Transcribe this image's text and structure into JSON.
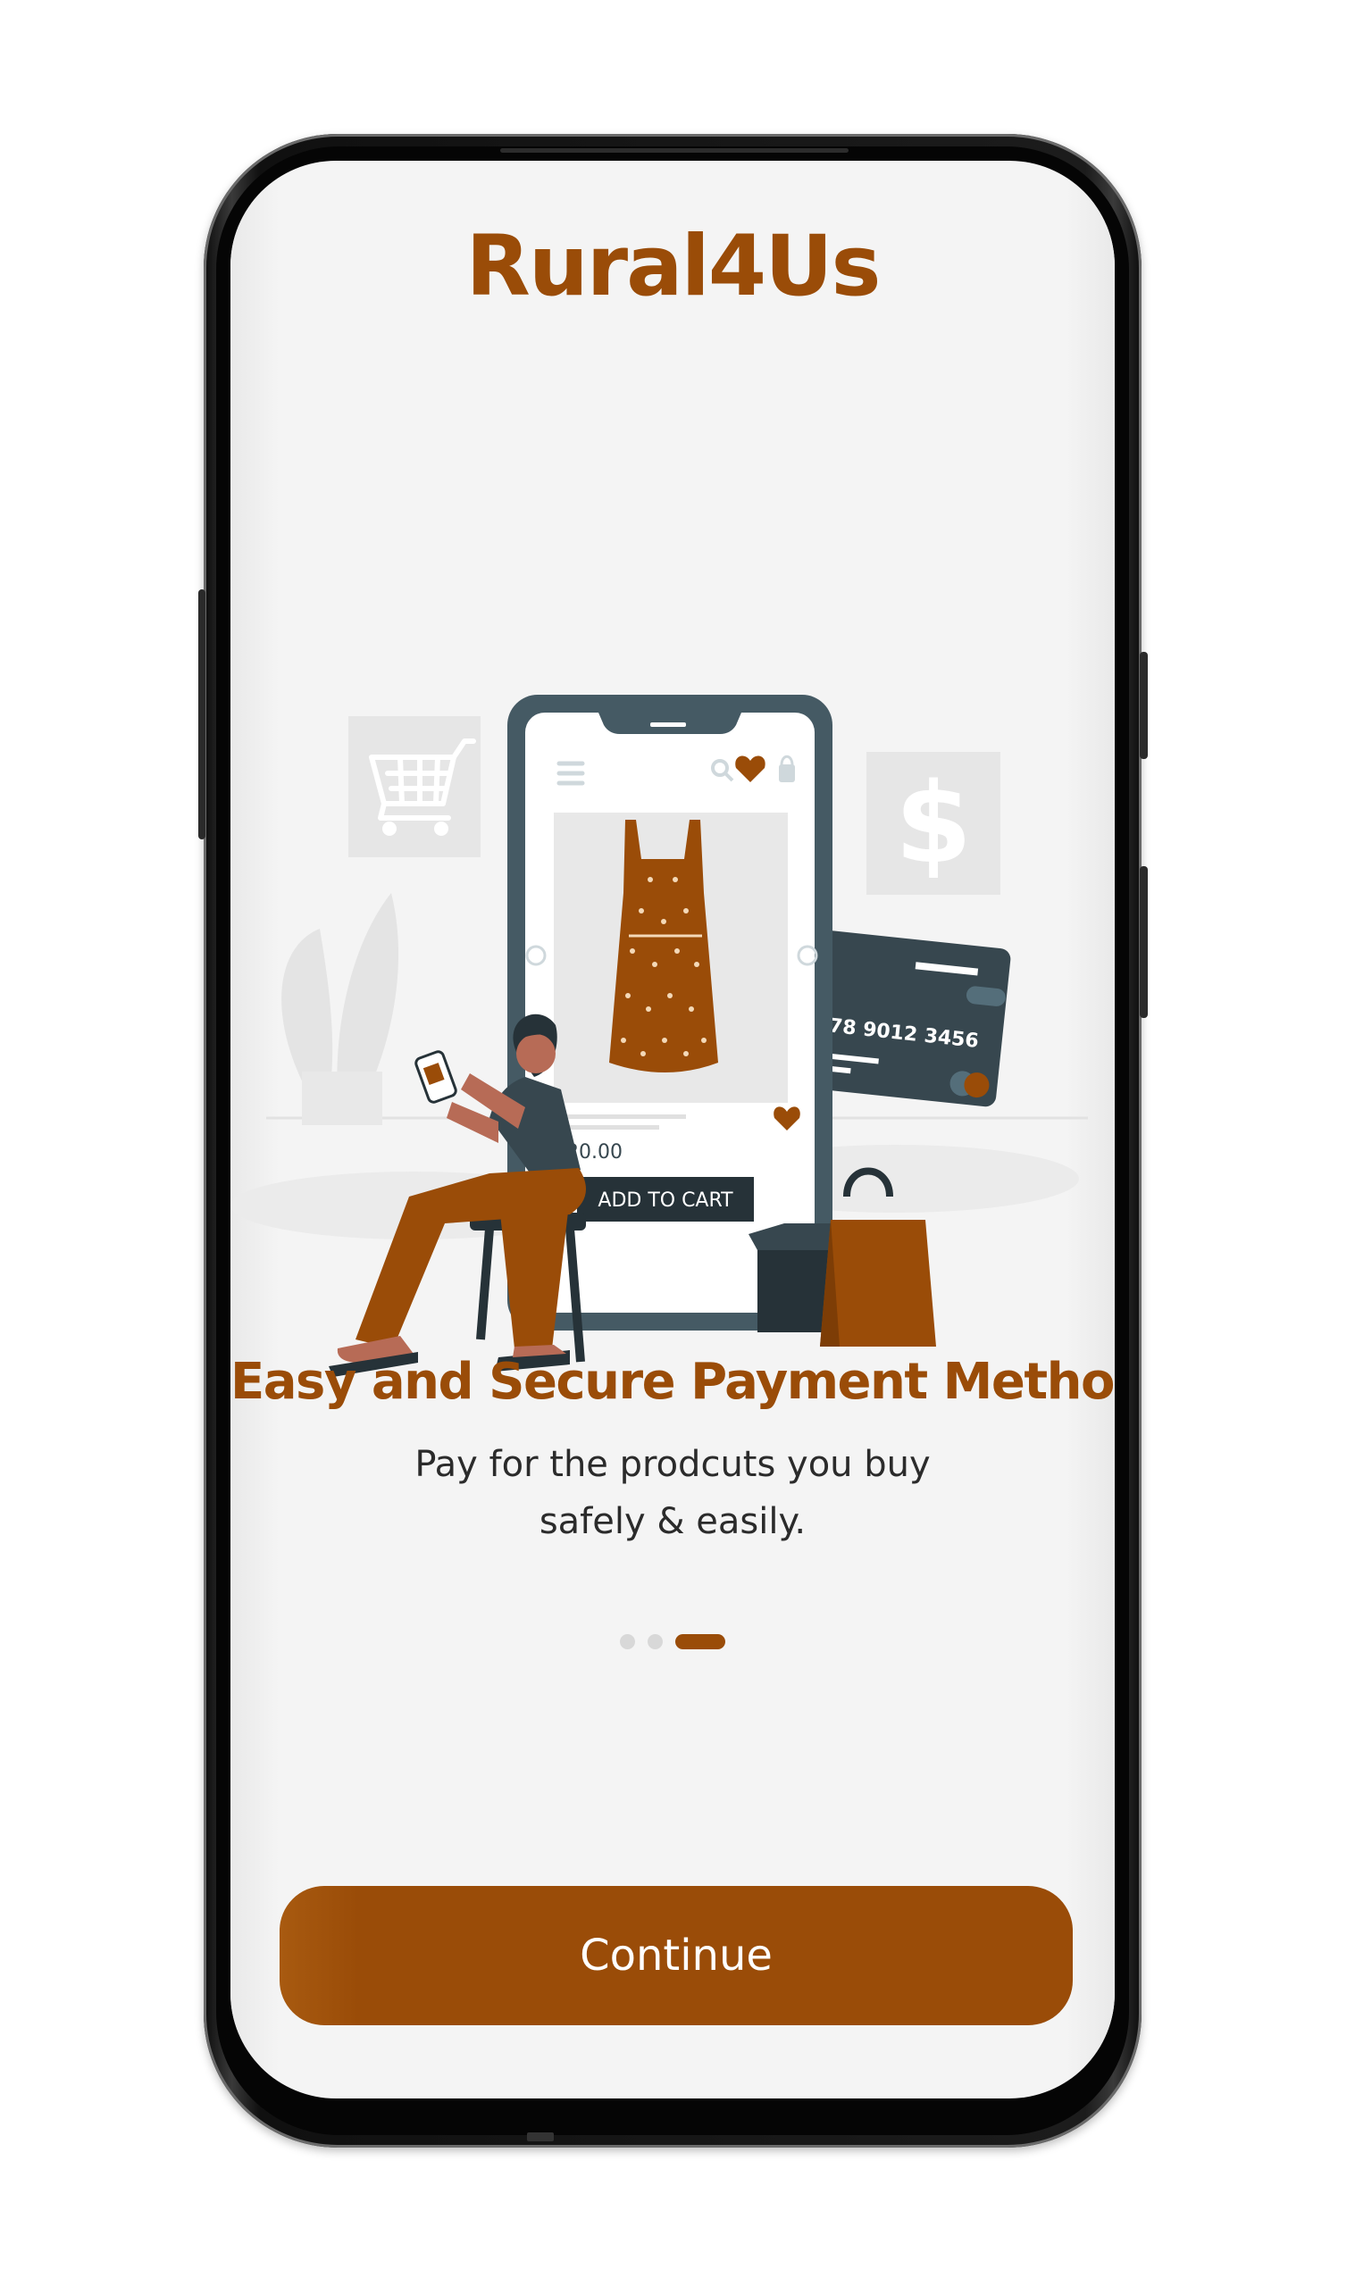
{
  "app": {
    "title": "Rural4Us"
  },
  "illustration": {
    "price": "$20.00",
    "add_to_cart_label": "ADD TO CART",
    "card_number": "5678 9012 3456",
    "currency_symbol": "$"
  },
  "onboarding": {
    "headline": "Easy and Secure Payment Method",
    "subtitle_line1": "Pay for the prodcuts you buy",
    "subtitle_line2": "safely & easily.",
    "page_count": 3,
    "active_page": 3
  },
  "actions": {
    "continue_label": "Continue"
  },
  "colors": {
    "brand": "#9a4c08",
    "screen_background": "#f4f4f4",
    "dark_slate": "#37474f",
    "inactive_dot": "#d8d8d8"
  }
}
